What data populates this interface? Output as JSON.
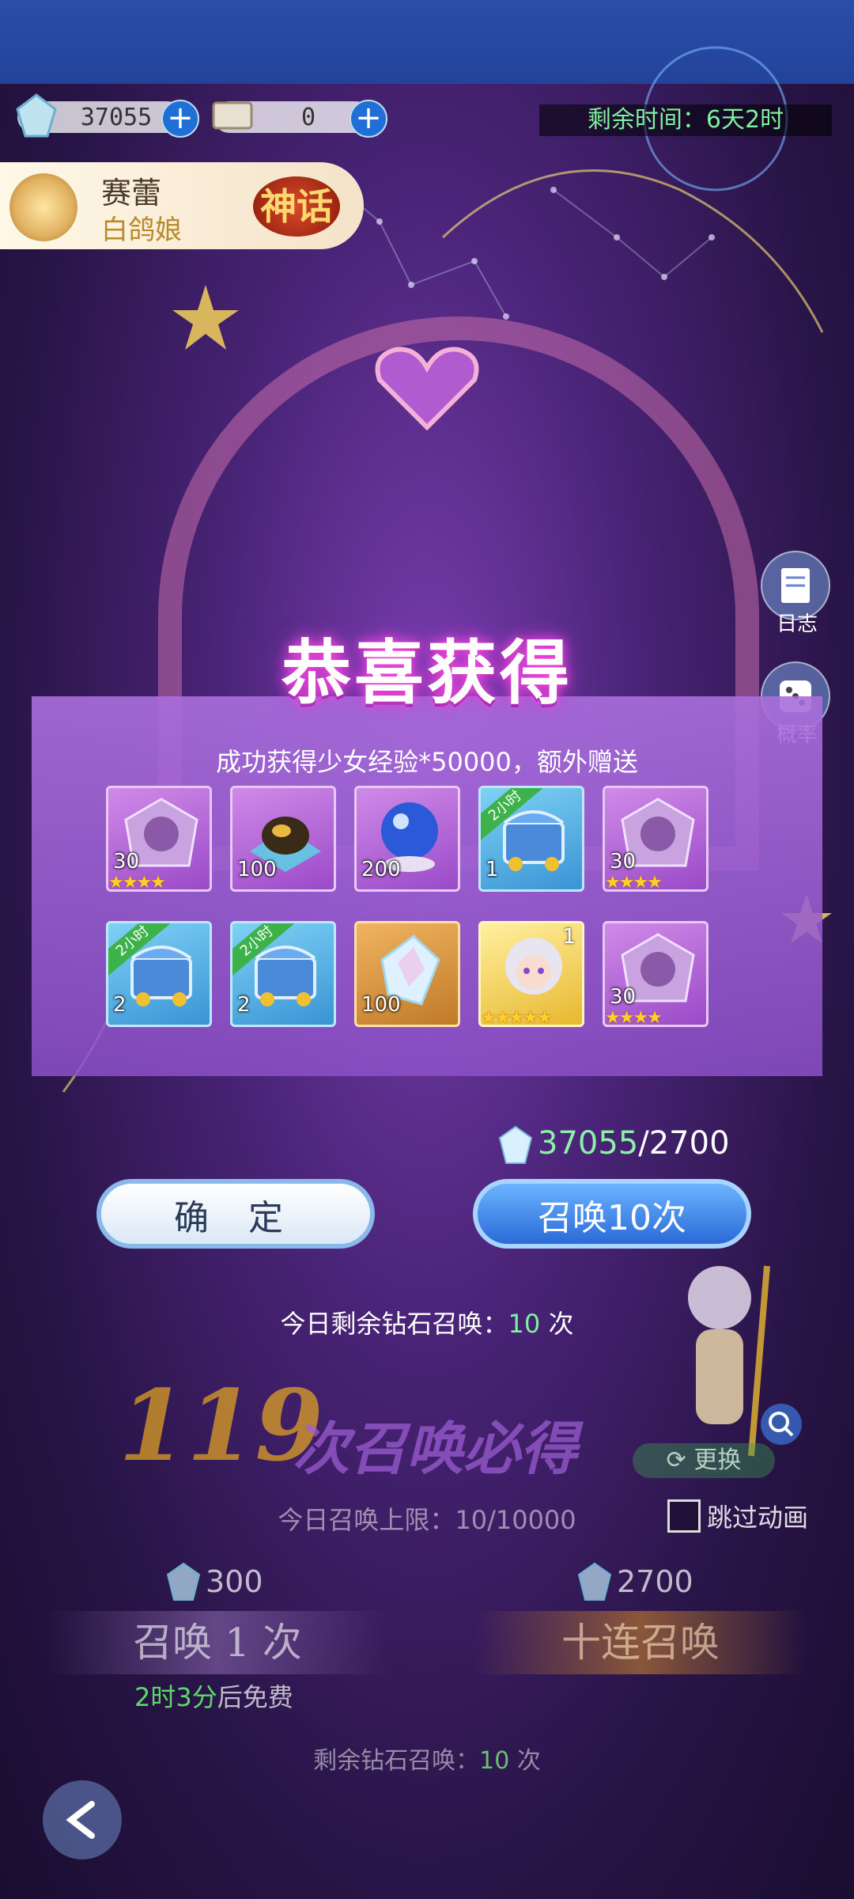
{
  "resources": {
    "gems": "37055",
    "tickets": "0"
  },
  "timer": "剩余时间：6天2时",
  "character": {
    "name": "赛蕾",
    "title": "白鸽娘",
    "rarity_badge": "神话"
  },
  "side_buttons": [
    {
      "label": "日志",
      "icon": "journal-icon"
    },
    {
      "label": "概率",
      "icon": "dice-icon"
    }
  ],
  "reward_popup": {
    "title": "恭喜获得",
    "subtitle": "成功获得少女经验*50000，额外赠送",
    "items": [
      {
        "icon": "purple-shard-icon",
        "count": "30",
        "stars": 4,
        "tier": "purple"
      },
      {
        "icon": "gold-ore-icon",
        "count": "100",
        "tier": "purple"
      },
      {
        "icon": "crystal-orb-icon",
        "count": "200",
        "tier": "purple"
      },
      {
        "icon": "treasure-chest-icon",
        "count": "1",
        "badge": "2小时",
        "tier": "blue"
      },
      {
        "icon": "purple-shard-icon",
        "count": "30",
        "stars": 4,
        "tier": "purple"
      },
      {
        "icon": "treasure-chest-icon",
        "count": "2",
        "badge": "2小时",
        "tier": "blue"
      },
      {
        "icon": "treasure-chest-icon",
        "count": "2",
        "badge": "2小时",
        "tier": "blue"
      },
      {
        "icon": "rainbow-crystal-icon",
        "count": "100",
        "tier": "orange"
      },
      {
        "icon": "character-portrait-icon",
        "count": "1",
        "stars": 5,
        "tier": "gold"
      },
      {
        "icon": "purple-shard-icon",
        "count": "30",
        "stars": 4,
        "tier": "purple"
      }
    ],
    "cost_have": "37055",
    "cost_need": "/2700",
    "confirm_label": "确 定",
    "summon10_label": "召唤10次",
    "today_left_prefix": "今日剩余钻石召唤：",
    "today_left_count": "10",
    "today_left_suffix": " 次"
  },
  "background": {
    "pity_number": "119",
    "pity_text": "次召唤必得",
    "change_label": "更换",
    "summon_limit": "今日召唤上限：10/10000",
    "skip_label": "跳过动画",
    "price_single": "300",
    "price_ten": "2700",
    "summon1_label": "召唤 1 次",
    "summon10_label": "十连召唤",
    "free_time": "2时3分",
    "free_suffix": "后免费",
    "bottom_left_prefix": "剩余钻石召唤：",
    "bottom_left_count": "10",
    "bottom_left_suffix": " 次"
  },
  "colors": {
    "panel": "#a46ed8",
    "accent_green": "#7ff0a0",
    "summon_blue": "#2a6ad8",
    "title_glow": "#ff4adf"
  }
}
